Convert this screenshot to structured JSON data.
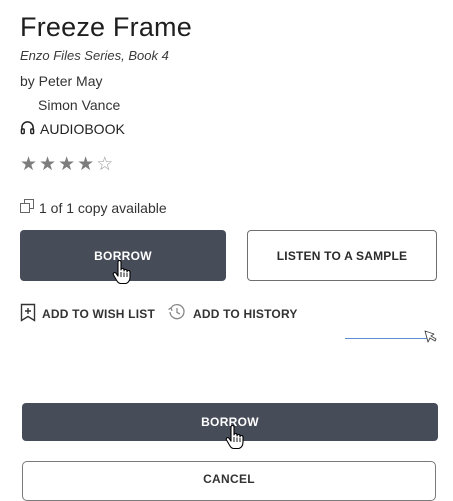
{
  "book": {
    "title": "Freeze Frame",
    "series": "Enzo Files Series, Book 4",
    "author_line": "by Peter May",
    "narrator": "Simon Vance",
    "format": "AUDIOBOOK",
    "rating": {
      "stars_filled": 4,
      "stars_total": 5
    },
    "availability": "1 of 1 copy available"
  },
  "buttons": {
    "borrow": "BORROW",
    "listen_sample": "LISTEN TO A SAMPLE",
    "add_wish_list": "ADD TO WISH LIST",
    "add_history": "ADD TO HISTORY"
  },
  "dialog": {
    "borrow": "BORROW",
    "cancel": "CANCEL"
  },
  "icons": {
    "format": "headphones-icon",
    "availability": "copies-icon",
    "wish_list": "bookmark-plus-icon",
    "history": "history-clock-icon",
    "cursor": "hand-pointer-icon"
  },
  "colors": {
    "primary_button": "#474c59",
    "star": "#7d7d7d",
    "link_line": "#5b8ed6"
  }
}
